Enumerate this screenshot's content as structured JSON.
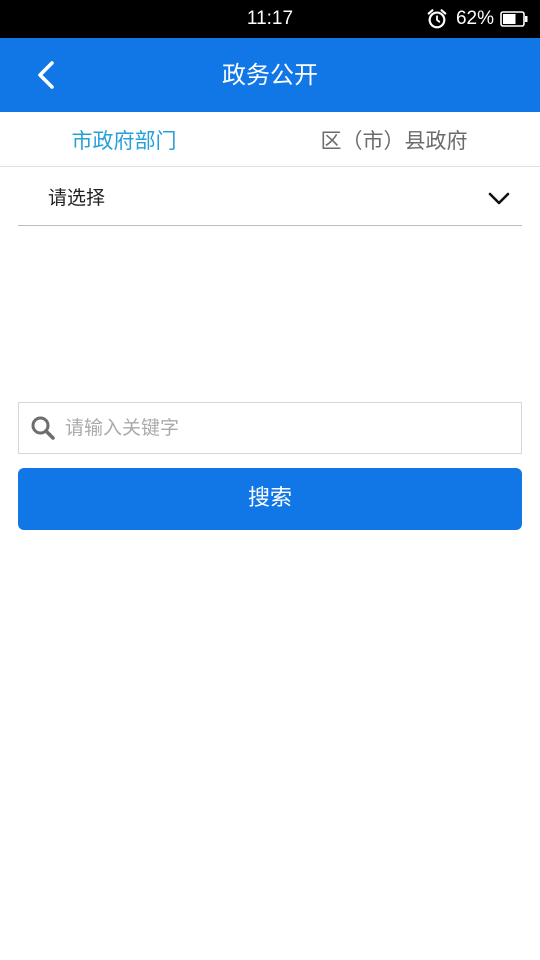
{
  "status_bar": {
    "time": "11:17",
    "battery_percent": "62%",
    "icons": [
      "alarm-icon",
      "battery-icon"
    ]
  },
  "header": {
    "title": "政务公开",
    "back_icon": "chevron-left-icon"
  },
  "tabs": [
    {
      "label": "市政府部门",
      "active": true
    },
    {
      "label": "区（市）县政府",
      "active": false
    }
  ],
  "dropdown": {
    "selected": "请选择",
    "icon": "chevron-down-icon"
  },
  "search": {
    "placeholder": "请输入关键字",
    "value": "",
    "icon": "search-icon",
    "button_label": "搜索"
  },
  "colors": {
    "primary": "#1277e6",
    "active_tab": "#27a0da",
    "inactive_tab": "#6b6b6b",
    "status_bar": "#000000"
  }
}
